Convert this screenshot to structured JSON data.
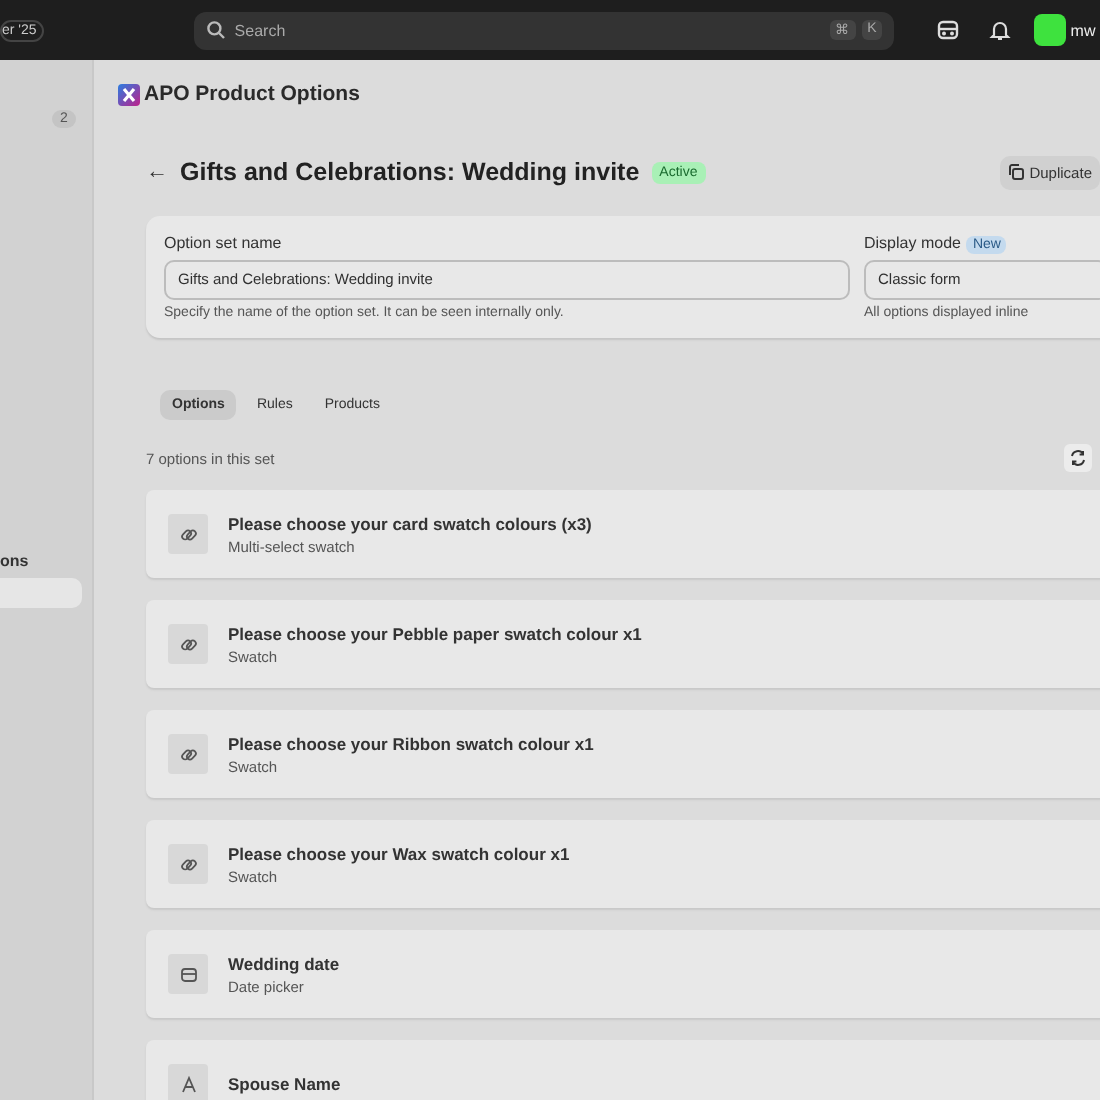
{
  "top_bar": {
    "date_pill": "er '25",
    "search": {
      "placeholder": "Search",
      "shortcut": [
        "⌘",
        "K"
      ]
    },
    "user_initials": "mw"
  },
  "sidebar": {
    "badge": "2",
    "item_label": "ons",
    "items": [
      {
        "selected": true
      }
    ]
  },
  "app_title": "APO Product Options",
  "header": {
    "back": "←",
    "title": "Gifts and Celebrations: Wedding invite",
    "status": "Active",
    "duplicate_button": "Duplicate"
  },
  "settings": {
    "name_label": "Option set name",
    "name_value": "Gifts and Celebrations: Wedding invite",
    "name_help": "Specify the name of the option set. It can be seen internally only.",
    "mode_label": "Display mode",
    "mode_badge": "New",
    "mode_value": "Classic form",
    "mode_help": "All options displayed inline"
  },
  "tabs": [
    {
      "label": "Options",
      "selected": true
    },
    {
      "label": "Rules",
      "selected": false
    },
    {
      "label": "Products",
      "selected": false
    }
  ],
  "count_text": "7 options in this set",
  "options": [
    {
      "kind": "swatch",
      "title": "Please choose your card swatch colours (x3)",
      "subtitle": "Multi-select swatch"
    },
    {
      "kind": "swatch",
      "title": "Please choose your Pebble paper swatch colour x1",
      "subtitle": "Swatch"
    },
    {
      "kind": "swatch",
      "title": "Please choose your Ribbon swatch colour x1",
      "subtitle": "Swatch"
    },
    {
      "kind": "swatch",
      "title": "Please choose your Wax swatch colour x1",
      "subtitle": "Swatch"
    },
    {
      "kind": "date",
      "title": "Wedding date",
      "subtitle": "Date picker"
    },
    {
      "kind": "text",
      "title": "Spouse Name"
    }
  ]
}
